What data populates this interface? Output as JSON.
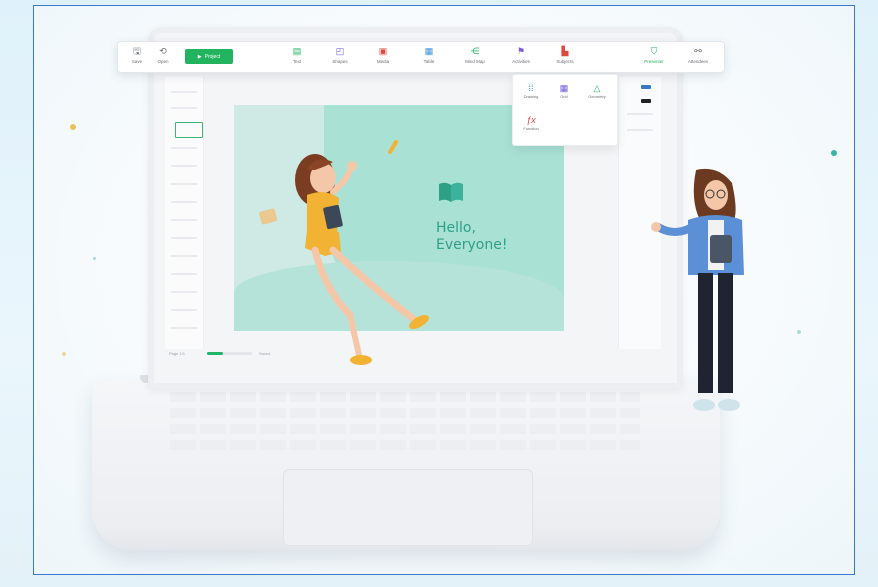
{
  "toolbar": {
    "left_tools": [
      {
        "label": "Save",
        "icon": "save-icon"
      },
      {
        "label": "Open",
        "icon": "open-icon"
      }
    ],
    "play_label": "Project",
    "tools": [
      {
        "label": "Text",
        "icon": "text-icon"
      },
      {
        "label": "Shapes",
        "icon": "shapes-icon"
      },
      {
        "label": "Media",
        "icon": "media-icon"
      },
      {
        "label": "Table",
        "icon": "table-icon"
      },
      {
        "label": "Mind Map",
        "icon": "mind-map-icon"
      },
      {
        "label": "Activities",
        "icon": "activities-icon"
      },
      {
        "label": "Subjects",
        "icon": "subjects-icon"
      }
    ],
    "right_tools": [
      {
        "label": "Presenter",
        "icon": "presenter-icon"
      },
      {
        "label": "Attendees",
        "icon": "attendees-icon"
      }
    ]
  },
  "subjects_menu": [
    {
      "label": "Drawing",
      "icon": "drawing-icon"
    },
    {
      "label": "Grid",
      "icon": "grid-icon"
    },
    {
      "label": "Geometry",
      "icon": "geometry-icon"
    },
    {
      "label": "Function",
      "icon": "function-icon"
    }
  ],
  "slide": {
    "title_line1": "Hello,",
    "title_line2": "Everyone!"
  },
  "status": {
    "left_text": "Page 1/1",
    "progress_text": "Saved",
    "progress_fraction": 0.35
  },
  "colors": {
    "accent": "#22b35e",
    "slide_bg": "#cfe9e4",
    "slide_text": "#2f9f86",
    "frame_border": "#3a78c9"
  }
}
